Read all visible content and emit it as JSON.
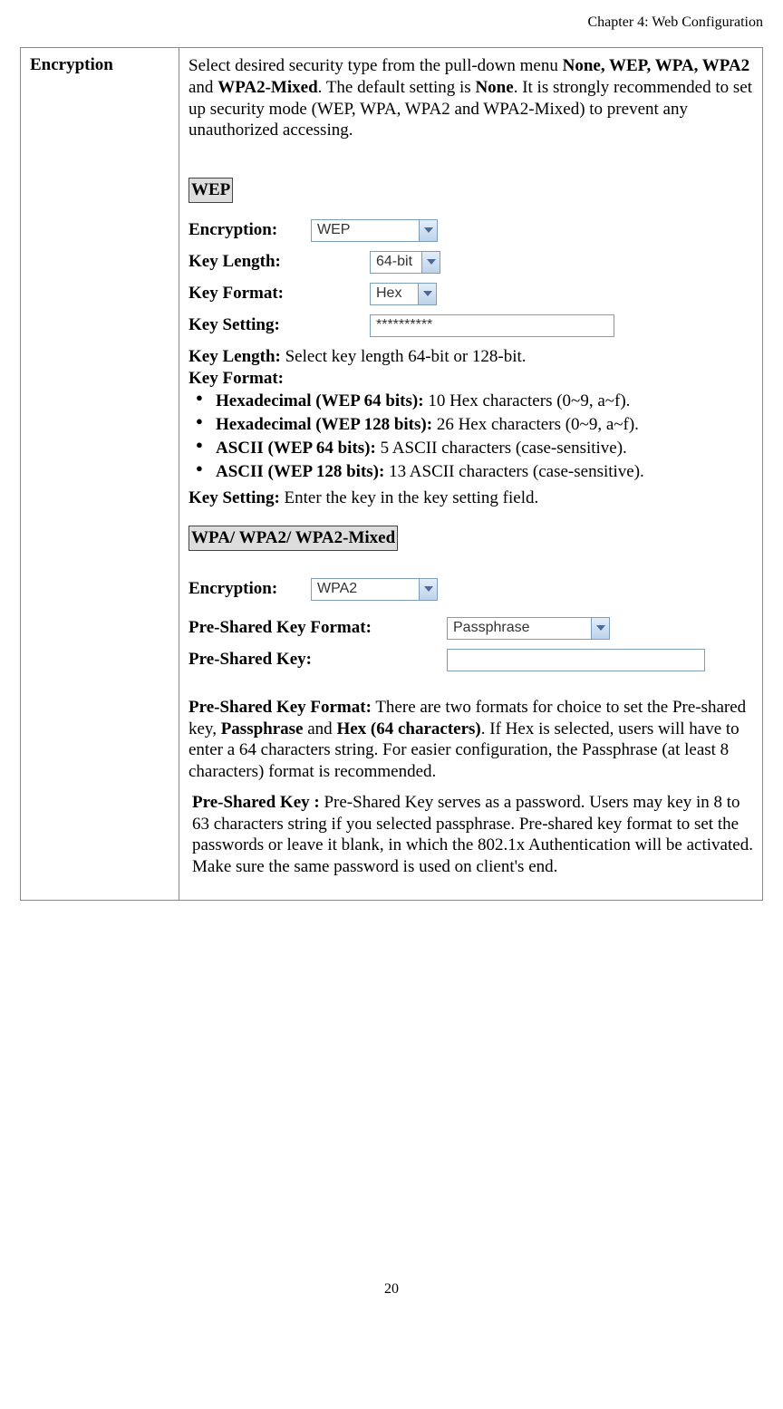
{
  "chapter": "Chapter 4: Web Configuration",
  "page_number": "20",
  "label_col": "Encryption",
  "intro": {
    "pre": "Select desired security type from the pull-down menu ",
    "opts": "None, WEP,  WPA, WPA2",
    "and": " and ",
    "mixed": "WPA2-Mixed",
    "dot": ". The default setting is ",
    "none": "None",
    "tail": ". It is strongly recommended to set up security mode (WEP,  WPA, WPA2 and WPA2-Mixed) to prevent any unauthorized accessing."
  },
  "wep": {
    "heading": "WEP",
    "form": {
      "encryption_label": "Encryption:",
      "encryption_value": "WEP",
      "keylength_label": "Key Length:",
      "keylength_value": "64-bit",
      "keyformat_label": "Key Format:",
      "keyformat_value": "Hex",
      "keysetting_label": "Key Setting:",
      "keysetting_value": "**********"
    },
    "keylength_desc_label": "Key Length:",
    "keylength_desc_text": " Select key length 64-bit or 128-bit.",
    "keyformat_desc_label": "Key Format:",
    "bullets": [
      {
        "b": "Hexadecimal (WEP 64 bits):",
        "t": " 10 Hex characters (0~9, a~f)."
      },
      {
        "b": "Hexadecimal (WEP 128 bits):",
        "t": " 26 Hex characters (0~9, a~f)."
      },
      {
        "b": "ASCII (WEP 64 bits):",
        "t": " 5 ASCII characters (case-sensitive)."
      },
      {
        "b": "ASCII (WEP 128 bits):",
        "t": " 13 ASCII characters (case-sensitive)."
      }
    ],
    "keysetting_desc_label": "Key Setting:",
    "keysetting_desc_text": " Enter the key in the key setting field."
  },
  "wpa": {
    "heading": "WPA/ WPA2/ WPA2-Mixed",
    "form": {
      "encryption_label": "Encryption:",
      "encryption_value": "WPA2",
      "pskformat_label": "Pre-Shared Key Format:",
      "pskformat_value": "Passphrase",
      "psk_label": "Pre-Shared Key:",
      "psk_value": ""
    },
    "pskformat_desc": {
      "label": "Pre-Shared Key Format:",
      "t1": "  There are two formats for choice to set the Pre-shared key, ",
      "b1": "Passphrase",
      "t2": " and ",
      "b2": "Hex (64 characters)",
      "t3": ". If Hex is selected, users will have to enter a 64 characters string. For easier configuration, the Passphrase (at least 8 characters) format is recommended."
    },
    "psk_desc": {
      "label": "Pre-Shared Key :",
      "text": " Pre-Shared Key serves as a password. Users may key in 8 to 63 characters string if you selected passphrase. Pre-shared key format to set the passwords or leave it blank, in which the 802.1x Authentication will be activated. Make sure the same password is used on client's end."
    }
  }
}
